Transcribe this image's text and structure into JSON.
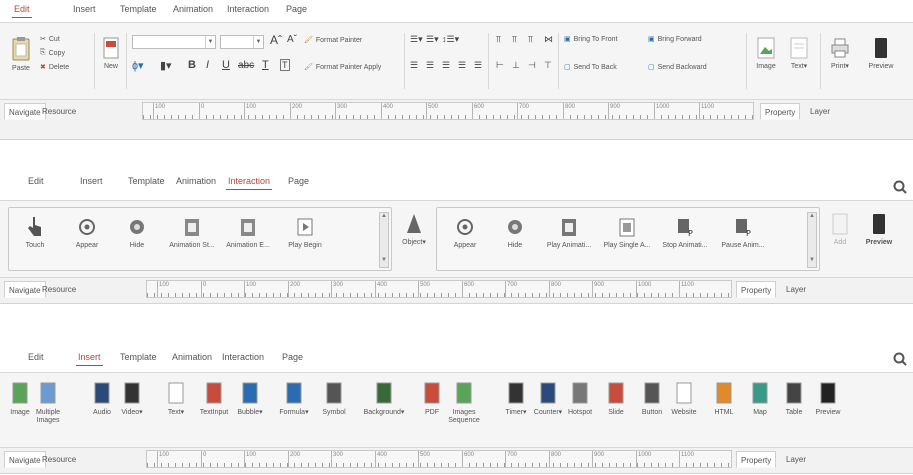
{
  "panel1": {
    "tabs": [
      "Edit",
      "Insert",
      "Template",
      "Animation",
      "Interaction",
      "Page"
    ],
    "active_tab": "Edit",
    "clipboard": {
      "paste": "Paste",
      "cut": "Cut",
      "copy": "Copy",
      "delete": "Delete"
    },
    "new": "New",
    "font": {
      "bold": "B",
      "italic": "I",
      "underline": "U",
      "strike": "abc",
      "text_color": "T",
      "grow": "Aˆ",
      "shrink": "Aˇ"
    },
    "format_painter": "Format Painter",
    "format_painter_apply": "Format Painter Apply",
    "arrange": {
      "bring_front": "Bring To Front",
      "bring_forward": "Bring Forward",
      "send_back": "Send To Back",
      "send_backward": "Send Backward"
    },
    "right_buttons": [
      "Image",
      "Text▾",
      "Print▾",
      "Preview"
    ],
    "left_tabs": [
      "Navigate",
      "Resource"
    ],
    "right_tabs": [
      "Property",
      "Layer"
    ]
  },
  "panel2": {
    "tabs": [
      "Edit",
      "Insert",
      "Template",
      "Animation",
      "Interaction",
      "Page"
    ],
    "active_tab": "Interaction",
    "triggers": [
      "Touch",
      "Appear",
      "Hide",
      "Animation St...",
      "Animation E...",
      "Play Begin"
    ],
    "object": "Object▾",
    "actions": [
      "Appear",
      "Hide",
      "Play Animati...",
      "Play Single A...",
      "Stop Animati...",
      "Pause Anim..."
    ],
    "add": "Add",
    "preview": "Preview",
    "left_tabs": [
      "Navigate",
      "Resource"
    ],
    "right_tabs": [
      "Property",
      "Layer"
    ]
  },
  "panel3": {
    "tabs": [
      "Edit",
      "Insert",
      "Template",
      "Animation",
      "Interaction",
      "Page"
    ],
    "active_tab": "Insert",
    "buttons": [
      "Image",
      "Multiple Images",
      "Audio",
      "Video▾",
      "Text▾",
      "TextInput",
      "Bubble▾",
      "Formula▾",
      "Symbol",
      "Background▾",
      "PDF",
      "Images Sequence",
      "Timer▾",
      "Counter▾",
      "Hotspot",
      "Slide",
      "Button",
      "Website",
      "HTML",
      "Map",
      "Table",
      "Preview"
    ],
    "left_tabs": [
      "Navigate",
      "Resource"
    ],
    "right_tabs": [
      "Property",
      "Layer"
    ]
  },
  "ruler_labels": [
    "100",
    "0",
    "100",
    "200",
    "300",
    "400",
    "500",
    "600",
    "700",
    "800",
    "900",
    "1000",
    "1100"
  ],
  "colors": {
    "accent": "#b5453b",
    "ribbon_bg": "#f5f5f5",
    "border": "#d8d8d8"
  }
}
